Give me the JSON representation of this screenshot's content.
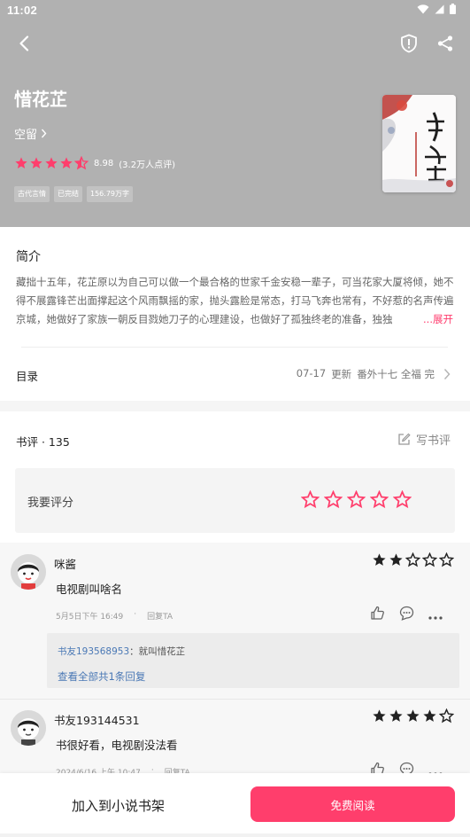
{
  "status_bar": {
    "time": "11:02"
  },
  "book": {
    "title": "惜花芷",
    "author": "空留",
    "rating_score": "8.98",
    "rating_count": "(3.2万人点评)",
    "rating_stars": 4.5,
    "tags": [
      "古代言情",
      "已完结",
      "156.79万字"
    ]
  },
  "intro": {
    "heading": "简介",
    "text": "藏拙十五年，花芷原以为自己可以做一个最合格的世家千金安稳一辈子，可当花家大厦将倾，她不得不展露锋芒出面撑起这个风雨飘摇的家，抛头露脸是常态，打马飞奔也常有，不好惹的名声传遍京城，她做好了家族一朝反目戮她刀子的心理建设，也做好了孤独终老的准备，独独",
    "expand_label": "...展开"
  },
  "catalog": {
    "label": "目录",
    "date": "07-17",
    "update": "更新",
    "latest_chapter": "番外十七 全福 完"
  },
  "reviews": {
    "title": "书评 · 135",
    "write_label": "写书评",
    "my_rating_label": "我要评分",
    "comments": [
      {
        "name": "咪酱",
        "stars": 2,
        "text": "电视剧叫啥名",
        "time": "5月5日下午 16:49",
        "dot": "·",
        "reply_label": "回复TA",
        "reply": {
          "user": "书友193568953",
          "text": "：就叫惜花芷",
          "view_all": "查看全部共1条回复"
        }
      },
      {
        "name": "书友193144531",
        "stars": 4,
        "text": "书很好看，电视剧没法看",
        "time": "2024/6/16 上午 10:47",
        "dot": "·",
        "reply_label": "回复TA"
      }
    ]
  },
  "bottom": {
    "shelf_label": "加入到小说书架",
    "read_label": "免费阅读"
  },
  "colors": {
    "accent": "#ff3e6c",
    "header_bg": "#b1b1b1",
    "link": "#4a78b5"
  }
}
